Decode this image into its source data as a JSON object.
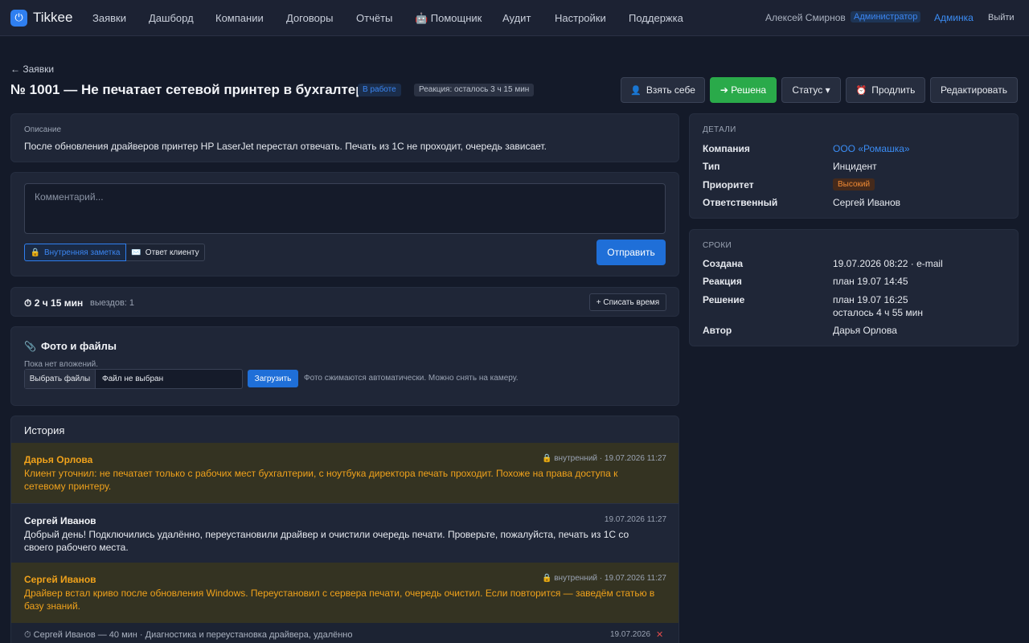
{
  "app": {
    "name": "Tikkee"
  },
  "nav": {
    "items": [
      "Заявки",
      "Дашборд",
      "Компании",
      "Договоры",
      "Отчёты",
      "🤖 Помощник",
      "Аудит",
      "Настройки",
      "Поддержка"
    ],
    "user_name": "Алексей Смирнов",
    "role": "Администратор",
    "admin_link": "Админка",
    "logout": "Выйти"
  },
  "header": {
    "back": "← Заявки",
    "title": "№ 1001 — Не печатает сетевой принтер в бухгалтерии",
    "status": "В работе",
    "sla": "Реакция: осталось 3 ч 15 мин"
  },
  "actions": {
    "take": "Взять себе",
    "resolve": "➔ Решена",
    "status": "Статус ▾",
    "extend": "Продлить",
    "edit": "Редактировать"
  },
  "description": {
    "label": "Описание",
    "text": "После обновления драйверов принтер HP LaserJet перестал отвечать. Печать из 1С не проходит, очередь зависает."
  },
  "comment": {
    "placeholder": "Комментарий...",
    "internal_note": "Внутренняя заметка",
    "reply_client": "Ответ клиенту",
    "send": "Отправить"
  },
  "time": {
    "spent": "2 ч 15 мин",
    "visits": "выездов: 1",
    "log_button": "+ Списать время"
  },
  "files": {
    "title": "Фото и файлы",
    "empty": "Пока нет вложений.",
    "choose": "Выбрать файлы",
    "none_chosen": "Файл не выбран",
    "upload": "Загрузить",
    "hint": "Фото сжимаются автоматически. Можно снять на камеру."
  },
  "history": {
    "title": "История",
    "items": [
      {
        "author": "Дарья Орлова",
        "meta": "внутренний · 19.07.2026 11:27",
        "text": "Клиент уточнил: не печатает только с рабочих мест бухгалтерии, с ноутбука директора печать проходит. Похоже на права доступа к сетевому принтеру."
      },
      {
        "author": "Сергей Иванов",
        "meta": "19.07.2026 11:27",
        "text": "Добрый день! Подключились удалённо, переустановили драйвер и очистили очередь печати. Проверьте, пожалуйста, печать из 1С со своего рабочего места."
      },
      {
        "author": "Сергей Иванов",
        "meta": "внутренний · 19.07.2026 11:27",
        "text": "Драйвер встал криво после обновления Windows. Переустановил с сервера печати, очередь очистил. Если повторится — заведём статью в базу знаний."
      }
    ],
    "timelog": {
      "text": "Сергей Иванов — 40 мин · Диагностика и переустановка драйвера, удалённо",
      "date": "19.07.2026",
      "delete": "✕"
    }
  },
  "details": {
    "header": "ДЕТАЛИ",
    "company_label": "Компания",
    "company": "ООО «Ромашка»",
    "type_label": "Тип",
    "type": "Инцидент",
    "priority_label": "Приоритет",
    "priority": "Высокий",
    "assignee_label": "Ответственный",
    "assignee": "Сергей Иванов"
  },
  "deadlines": {
    "header": "СРОКИ",
    "created_label": "Создана",
    "created": "19.07.2026 08:22 · e-mail",
    "reaction_label": "Реакция",
    "reaction": "план 19.07 14:45",
    "resolution_label": "Решение",
    "resolution_plan": "план 19.07 16:25",
    "resolution_left": "осталось 4 ч 55 мин",
    "author_label": "Автор",
    "author": "Дарья Орлова"
  }
}
